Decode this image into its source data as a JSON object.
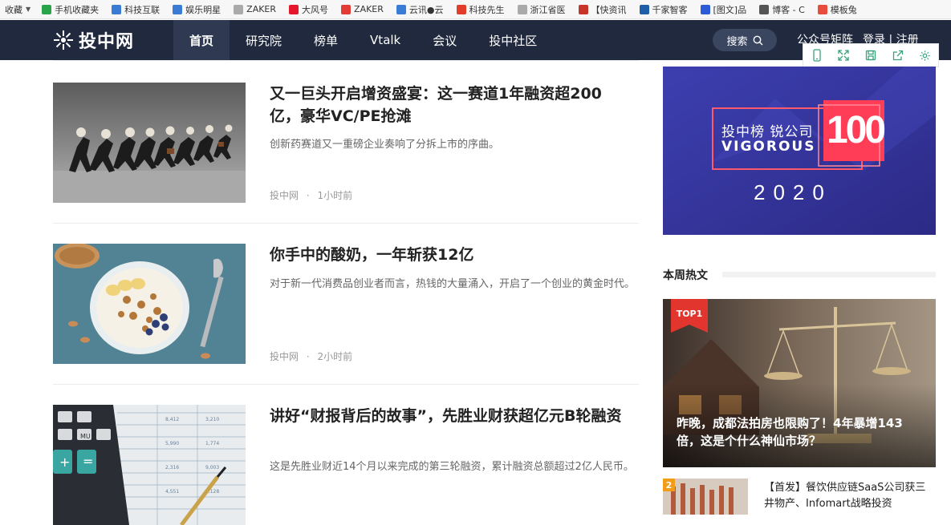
{
  "bookmarks": {
    "favorites_label": "收藏",
    "items": [
      {
        "label": "手机收藏夹",
        "icon": "phone-icon",
        "color": "#2aa44a"
      },
      {
        "label": "科技互联",
        "icon": "cloud-icon",
        "color": "#3a7bd5"
      },
      {
        "label": "娱乐明星",
        "icon": "cloud-icon",
        "color": "#3a7bd5"
      },
      {
        "label": "ZAKER",
        "icon": "page-icon",
        "color": "#aaaaaa"
      },
      {
        "label": "大风号",
        "icon": "weibo-icon",
        "color": "#e6162d"
      },
      {
        "label": "ZAKER",
        "icon": "z-icon",
        "color": "#e13d36"
      },
      {
        "label": "云讯●云",
        "icon": "cloud-icon",
        "color": "#3a7bd5"
      },
      {
        "label": "科技先生",
        "icon": "t-icon",
        "color": "#e23c2a"
      },
      {
        "label": "浙江省医",
        "icon": "page-icon",
        "color": "#aaaaaa"
      },
      {
        "label": "【快资讯",
        "icon": "kuai-icon",
        "color": "#c9342a"
      },
      {
        "label": "千家智客",
        "icon": "circle-icon",
        "color": "#1f5fa8"
      },
      {
        "label": "[图文]品",
        "icon": "paw-icon",
        "color": "#2e5bd8"
      },
      {
        "label": "博客 - C",
        "icon": "hammer-icon",
        "color": "#555555"
      },
      {
        "label": "模板兔",
        "icon": "heart-icon",
        "color": "#e74c3c"
      }
    ]
  },
  "site": {
    "logo_text": "投中网",
    "nav": [
      {
        "label": "首页",
        "active": true
      },
      {
        "label": "研究院",
        "active": false
      },
      {
        "label": "榜单",
        "active": false
      },
      {
        "label": "Vtalk",
        "active": false
      },
      {
        "label": "会议",
        "active": false
      },
      {
        "label": "投中社区",
        "active": false
      }
    ],
    "search_label": "搜索",
    "public_account_label": "公众号矩阵",
    "login_label": "登录 | 注册"
  },
  "articles": [
    {
      "title": "又一巨头开启增资盛宴：这一赛道1年融资超200亿，豪华VC/PE抢滩",
      "desc": "创新药赛道又一重磅企业奏响了分拆上市的序曲。",
      "source": "投中网",
      "time": "1小时前"
    },
    {
      "title": "你手中的酸奶，一年斩获12亿",
      "desc": "对于新一代消费品创业者而言，热钱的大量涌入，开启了一个创业的黄金时代。",
      "source": "投中网",
      "time": "2小时前"
    },
    {
      "title": "讲好“财报背后的故事”，先胜业财获超亿元B轮融资",
      "desc": "这是先胜业财近14个月以来完成的第三轮融资，累计融资总额超过2亿人民币。",
      "source": "",
      "time": ""
    }
  ],
  "banner": {
    "line1": "投中榜 锐公司",
    "line2": "VIGOROUS",
    "big_number": "100",
    "year": "2020"
  },
  "hot": {
    "section_title": "本周热文",
    "top_badge": "TOP1",
    "top_title": "昨晚，成都法拍房也限购了！4年暴增143倍，这是个什么神仙市场？",
    "second_rank": "2",
    "second_title": "【首发】餐饮供应链SaaS公司获三井物产、Infomart战略投资"
  }
}
